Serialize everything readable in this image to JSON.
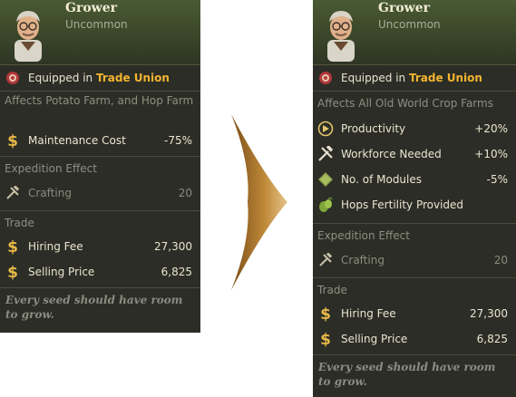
{
  "left_card": {
    "title": "Grower",
    "rarity": "Uncommon",
    "equipped_prefix": "Equipped in",
    "equipped_place": "Trade Union",
    "affects": "Affects Potato Farm, and Hop Farm",
    "effects": [
      {
        "icon": "coin-icon",
        "label": "Maintenance Cost",
        "value": "-75%"
      }
    ],
    "expedition_title": "Expedition Effect",
    "expedition": {
      "icon": "crafting-tools-icon",
      "label": "Crafting",
      "value": "20"
    },
    "trade_title": "Trade",
    "trade": [
      {
        "icon": "coin-icon",
        "label": "Hiring Fee",
        "value": "27,300"
      },
      {
        "icon": "coin-icon",
        "label": "Selling Price",
        "value": "6,825"
      }
    ],
    "quote": "Every seed should have room to grow."
  },
  "right_card": {
    "title": "Grower",
    "rarity": "Uncommon",
    "equipped_prefix": "Equipped in",
    "equipped_place": "Trade Union",
    "affects": "Affects All Old World Crop Farms",
    "effects": [
      {
        "icon": "productivity-gauge-icon",
        "label": "Productivity",
        "value": "+20%"
      },
      {
        "icon": "workforce-tools-icon",
        "label": "Workforce Needed",
        "value": "+10%"
      },
      {
        "icon": "module-tile-icon",
        "label": "No. of Modules",
        "value": "-5%"
      },
      {
        "icon": "hops-icon",
        "label": "Hops Fertility Provided",
        "value": ""
      }
    ],
    "expedition_title": "Expedition Effect",
    "expedition": {
      "icon": "crafting-tools-icon",
      "label": "Crafting",
      "value": "20"
    },
    "trade_title": "Trade",
    "trade": [
      {
        "icon": "coin-icon",
        "label": "Hiring Fee",
        "value": "27,300"
      },
      {
        "icon": "coin-icon",
        "label": "Selling Price",
        "value": "6,825"
      }
    ],
    "quote": "Every seed should have room to grow."
  },
  "colors": {
    "highlight": "#f2b531",
    "panel": "#2c2d26",
    "header_green": "#4a5a34",
    "arrow": "#b07a2a"
  }
}
